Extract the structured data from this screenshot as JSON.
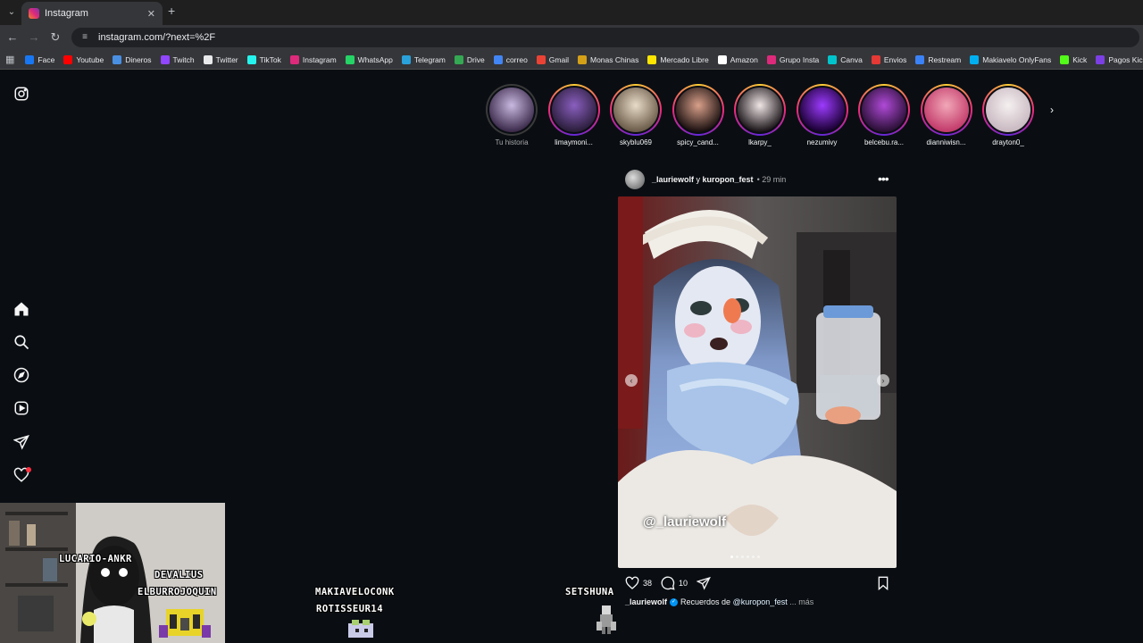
{
  "browser": {
    "tab_title": "Instagram",
    "url": "instagram.com/?next=%2F",
    "bookmarks": [
      {
        "label": "Face",
        "color": "#1877f2"
      },
      {
        "label": "Youtube",
        "color": "#ff0000"
      },
      {
        "label": "Dineros",
        "color": "#4a90e2"
      },
      {
        "label": "Twitch",
        "color": "#9146ff"
      },
      {
        "label": "Twitter",
        "color": "#e7e9ea"
      },
      {
        "label": "TikTok",
        "color": "#25f4ee"
      },
      {
        "label": "Instagram",
        "color": "#dd2a7b"
      },
      {
        "label": "WhatsApp",
        "color": "#25d366"
      },
      {
        "label": "Telegram",
        "color": "#2aa1da"
      },
      {
        "label": "Drive",
        "color": "#34a853"
      },
      {
        "label": "correo",
        "color": "#4285f4"
      },
      {
        "label": "Gmail",
        "color": "#ea4335"
      },
      {
        "label": "Monas Chinas",
        "color": "#d4a017"
      },
      {
        "label": "Mercado Libre",
        "color": "#ffe600"
      },
      {
        "label": "Amazon",
        "color": "#ffffff"
      },
      {
        "label": "Grupo Insta",
        "color": "#dd2a7b"
      },
      {
        "label": "Canva",
        "color": "#00c4cc"
      },
      {
        "label": "Envios",
        "color": "#e53935"
      },
      {
        "label": "Restream",
        "color": "#3b82f6"
      },
      {
        "label": "Makiavelo OnlyFans",
        "color": "#00aff0"
      },
      {
        "label": "Kick",
        "color": "#53fc18"
      },
      {
        "label": "Pagos Kick",
        "color": "#7b3fe4"
      }
    ]
  },
  "sidebar": {
    "icons": [
      "instagram-logo-icon",
      "home-icon",
      "search-icon",
      "explore-icon",
      "reels-icon",
      "messages-icon",
      "notifications-icon"
    ]
  },
  "stories": [
    {
      "label": "Tu historia",
      "own": true,
      "colors": [
        "#c9b8e0",
        "#3b2a4a"
      ]
    },
    {
      "label": "limaymoni...",
      "colors": [
        "#8a5fbf",
        "#2a1d3a"
      ]
    },
    {
      "label": "skyblu069",
      "colors": [
        "#e8dcc8",
        "#6a5a48"
      ]
    },
    {
      "label": "spicy_cand...",
      "colors": [
        "#d9a08a",
        "#1a1010"
      ]
    },
    {
      "label": "lkarpy_",
      "colors": [
        "#f0e6e6",
        "#1a1418"
      ]
    },
    {
      "label": "nezumivy",
      "colors": [
        "#9d3bff",
        "#1a0033"
      ]
    },
    {
      "label": "belcebu.ra...",
      "colors": [
        "#b04ad8",
        "#2a0f35"
      ]
    },
    {
      "label": "dianniwisn...",
      "colors": [
        "#f2a7b8",
        "#c23a6a"
      ]
    },
    {
      "label": "drayton0_",
      "colors": [
        "#f5f0f0",
        "#c8b8c0"
      ]
    }
  ],
  "post": {
    "users": "_lauriewolf",
    "connector": "y",
    "collab": "kuropon_fest",
    "time": "• 29 min",
    "watermark": "@_lauriewolf",
    "likes": "38",
    "comments": "10",
    "caption_user": "_lauriewolf",
    "caption_text": "Recuerdos de",
    "caption_mention": "@kuropon_fest",
    "caption_more": "... más"
  },
  "overlay": {
    "names": [
      "LUCARIO-ANKR",
      "DEVALIUS",
      "ELBURROJOQUIN",
      "MAKIAVELOCONK",
      "ROTISSEUR14",
      "SETSHUNA"
    ]
  }
}
